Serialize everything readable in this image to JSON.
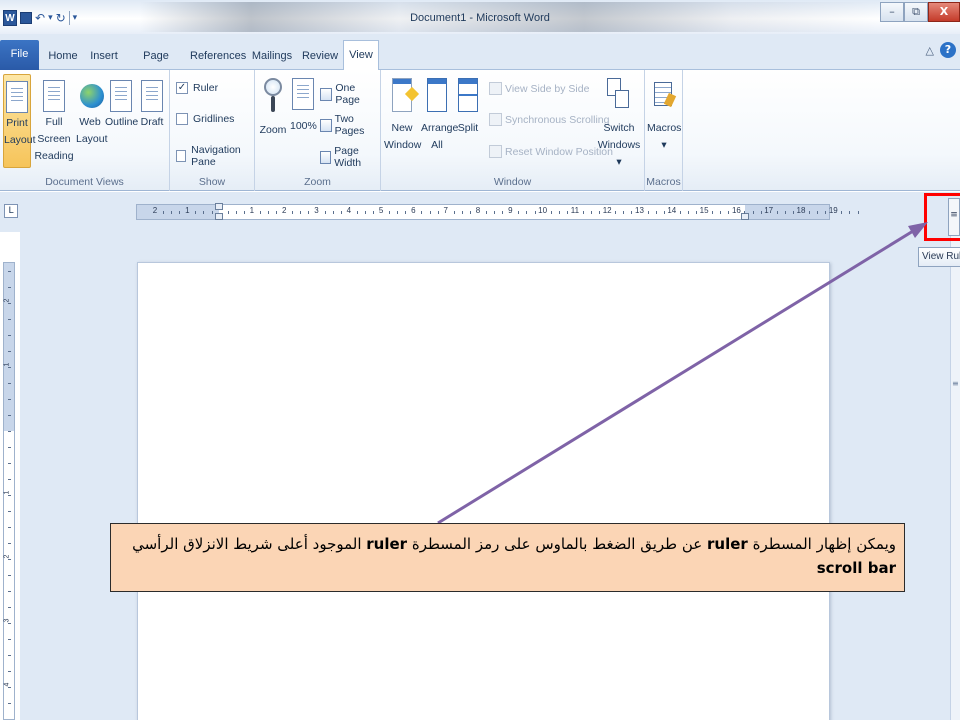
{
  "window": {
    "title": "Document1 - Microsoft Word",
    "app_icon_letter": "W",
    "minimize": "–",
    "restore": "⧉",
    "close": "X"
  },
  "qat": {
    "save_icon": "save-icon",
    "undo": "↶",
    "undo_dropdown": "▾",
    "redo": "↻",
    "customize": "▾"
  },
  "tabs": [
    {
      "label": "File"
    },
    {
      "label": "Home"
    },
    {
      "label": "Insert"
    },
    {
      "label": "Page Layout"
    },
    {
      "label": "References"
    },
    {
      "label": "Mailings"
    },
    {
      "label": "Review"
    },
    {
      "label": "View"
    }
  ],
  "help": {
    "caret": "△",
    "help": "?"
  },
  "ribbon": {
    "document_views": {
      "label": "Document Views",
      "print_layout": [
        "Print",
        "Layout"
      ],
      "full_screen": [
        "Full Screen",
        "Reading"
      ],
      "web_layout": [
        "Web",
        "Layout"
      ],
      "outline": "Outline",
      "draft": "Draft"
    },
    "show": {
      "label": "Show",
      "ruler": "Ruler",
      "ruler_checked": "✓",
      "gridlines": "Gridlines",
      "navigation_pane": "Navigation Pane"
    },
    "zoom": {
      "label": "Zoom",
      "zoom": "Zoom",
      "hundred": "100%",
      "one_page": "One Page",
      "two_pages": "Two Pages",
      "page_width": "Page Width"
    },
    "window": {
      "label": "Window",
      "new_window": [
        "New",
        "Window"
      ],
      "arrange_all": [
        "Arrange",
        "All"
      ],
      "split": "Split",
      "view_side_by_side": "View Side by Side",
      "synchronous_scrolling": "Synchronous Scrolling",
      "reset_window_position": "Reset Window Position",
      "switch_windows": [
        "Switch",
        "Windows ▾"
      ]
    },
    "macros": {
      "label": "Macros",
      "macros": "Macros",
      "dropdown": "▾"
    }
  },
  "ruler": {
    "tab_selector": "L",
    "numbers": [
      "2",
      "1",
      "",
      "1",
      "2",
      "3",
      "4",
      "5",
      "6",
      "7",
      "8",
      "9",
      "10",
      "11",
      "12",
      "13",
      "14",
      "15",
      "16",
      "17",
      "18",
      "19"
    ]
  },
  "vruler": {
    "numbers": [
      "2",
      "1",
      "1",
      "2",
      "3",
      "4"
    ]
  },
  "view_ruler_button": "≡",
  "tooltip": "View Ruler",
  "callout": {
    "line1_a": "ويمكن إظهار المسطرة ",
    "kw1": "ruler",
    "line1_b": " عن طريق الضغط بالماوس على رمز المسطرة ",
    "kw2": "ruler",
    "line1_c": " الموجود أعلى شريط الانزلاق الرأسي ",
    "kw3": "scroll bar"
  },
  "colors": {
    "highlight": "#ff0000",
    "arrow": "#7f63a7",
    "callout_bg": "#fbd5b5",
    "file_tab": "#2a5aa8"
  }
}
